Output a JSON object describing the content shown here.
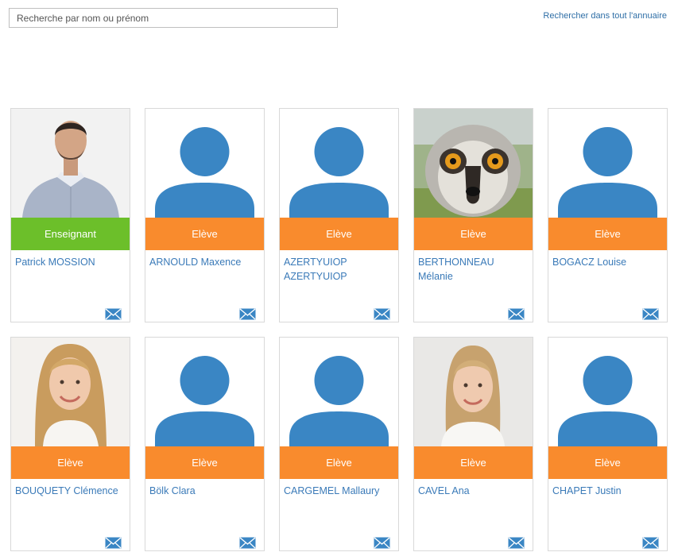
{
  "search": {
    "placeholder": "Recherche par nom ou prénom"
  },
  "header": {
    "directory_link": "Rechercher dans tout l'annuaire"
  },
  "colors": {
    "student_badge": "#f98b2d",
    "teacher_badge": "#6cbf2a",
    "name_link": "#3a7ab8",
    "avatar": "#3a86c4"
  },
  "people": [
    {
      "name": "Patrick MOSSION",
      "role": "Enseignant",
      "photo": "man-photo"
    },
    {
      "name": "ARNOULD Maxence",
      "role": "Elève",
      "photo": "default-avatar"
    },
    {
      "name": "AZERTYUIOP AZERTYUIOP",
      "role": "Elève",
      "photo": "default-avatar"
    },
    {
      "name": "BERTHONNEAU Mélanie",
      "role": "Elève",
      "photo": "lemur-photo"
    },
    {
      "name": "BOGACZ Louise",
      "role": "Elève",
      "photo": "default-avatar"
    },
    {
      "name": "BOUQUETY Clémence",
      "role": "Elève",
      "photo": "girl-photo"
    },
    {
      "name": "Bölk Clara",
      "role": "Elève",
      "photo": "default-avatar"
    },
    {
      "name": "CARGEMEL Mallaury",
      "role": "Elève",
      "photo": "default-avatar"
    },
    {
      "name": "CAVEL Ana",
      "role": "Elève",
      "photo": "girl-photo"
    },
    {
      "name": "CHAPET Justin",
      "role": "Elève",
      "photo": "default-avatar"
    }
  ]
}
